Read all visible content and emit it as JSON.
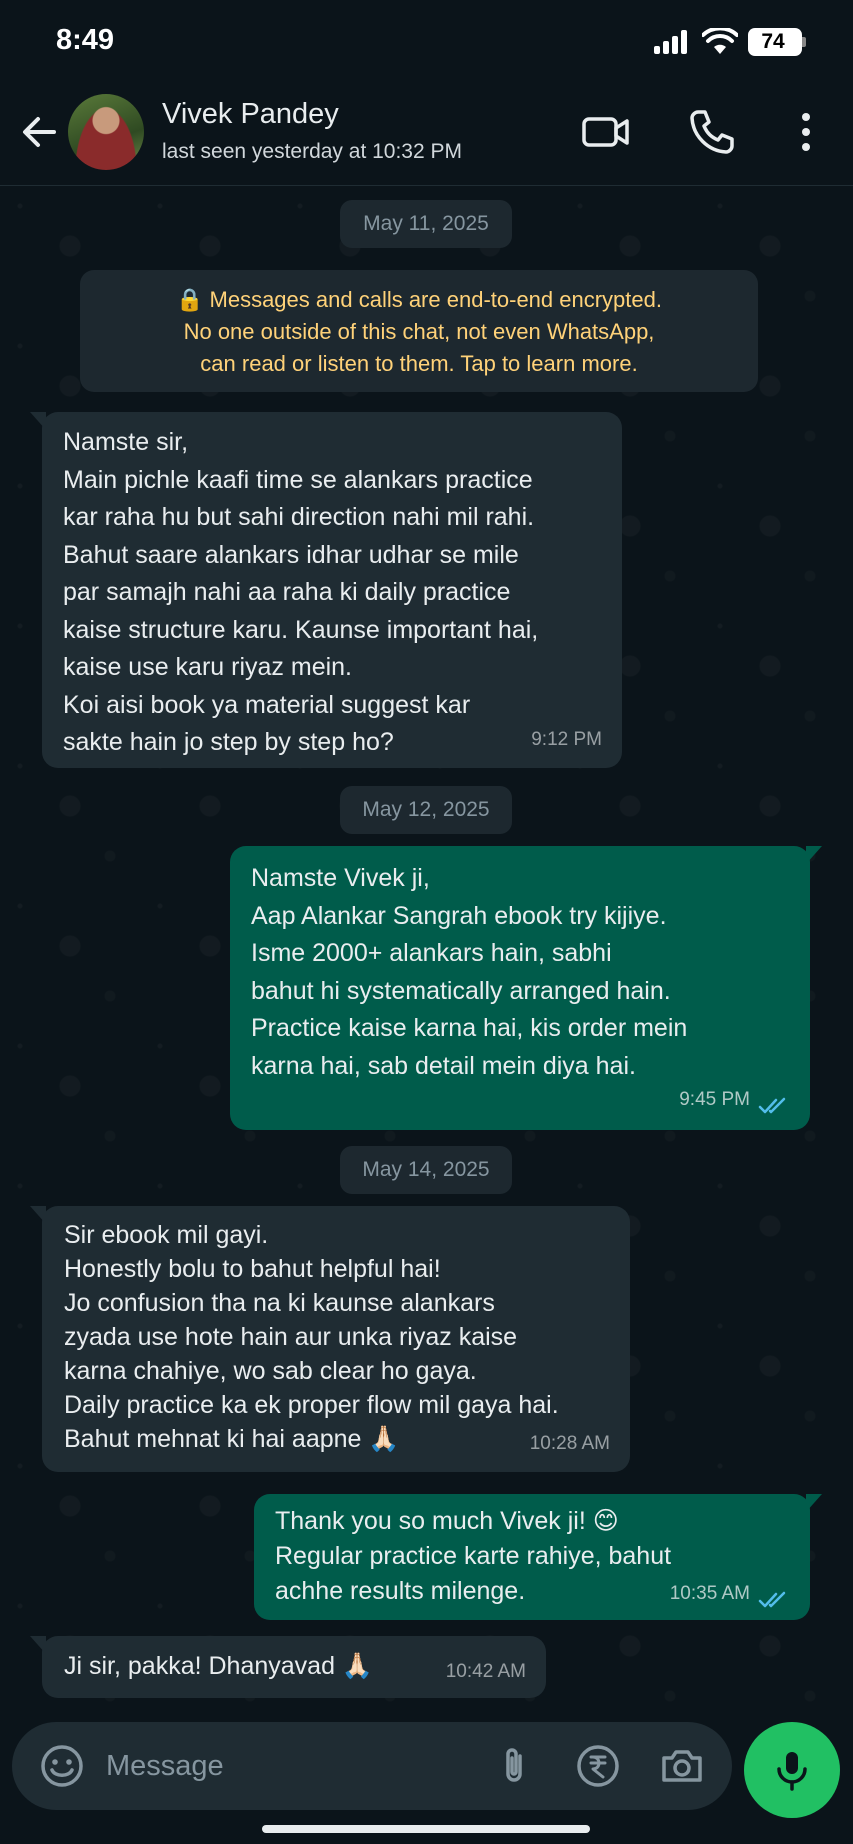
{
  "status_bar": {
    "time": "8:49",
    "battery": "74"
  },
  "header": {
    "contact_name": "Vivek Pandey",
    "contact_status": "last seen yesterday at 10:32 PM",
    "icons": [
      "back-arrow-icon",
      "video-call-icon",
      "voice-call-icon",
      "more-options-icon"
    ]
  },
  "chat": {
    "date_1": "May 11, 2025",
    "encryption_notice": [
      "🔒 Messages and calls are end-to-end encrypted.",
      "No one outside of this chat, not even WhatsApp,",
      "can read or listen to them. Tap to learn more."
    ],
    "messages": [
      {
        "direction": "in",
        "text": "Namste sir,\nMain pichle kaafi time se alankars practice\nkar raha hu but sahi direction nahi mil rahi.\nBahut saare alankars idhar udhar se mile\npar samajh nahi aa raha ki daily practice\nkaise structure karu. Kaunse important hai,\nkaise use karu riyaz mein.\nKoi aisi book ya material suggest kar\nsakte hain jo step by step ho?",
        "time": "9:12 PM"
      },
      {
        "direction": "out",
        "text": "Namste Vivek ji,\nAap Alankar Sangrah ebook try kijiye.\nIsme 2000+ alankars hain, sabhi\nbahut hi systematically arranged hain.\nPractice kaise karna hai, kis order mein\nkarna hai, sab detail mein diya hai.",
        "time": "9:45 PM",
        "status": "read"
      },
      {
        "direction": "in",
        "text": "Sir ebook mil gayi.\nHonestly bolu to bahut helpful hai!\nJo confusion tha na ki kaunse alankars\nzyada use hote hain aur unka riyaz kaise\nkarna chahiye, wo sab clear ho gaya.\nDaily practice ka ek proper flow mil gaya hai.\nBahut mehnat ki hai aapne 🙏🏻",
        "time": "10:28 AM"
      },
      {
        "direction": "out",
        "text": "Thank you so much Vivek ji! 😊\nRegular practice karte rahiye, bahut\nachhe results milenge.",
        "time": "10:35 AM",
        "status": "read"
      },
      {
        "direction": "in",
        "text": "Ji sir, pakka! Dhanyavad 🙏🏻",
        "time": "10:42 AM"
      }
    ],
    "date_2": "May 12, 2025",
    "date_3": "May 14, 2025"
  },
  "composer": {
    "placeholder": "Message",
    "icons": [
      "emoji-icon",
      "attach-icon",
      "rupee-payment-icon",
      "camera-icon",
      "mic-icon"
    ]
  },
  "colors": {
    "background": "#0b141a",
    "incoming_bubble": "#1f2c33",
    "outgoing_bubble": "#005c4b",
    "accent_green": "#21c063",
    "read_tick": "#53bdeb",
    "encryption_text": "#ffd279"
  }
}
